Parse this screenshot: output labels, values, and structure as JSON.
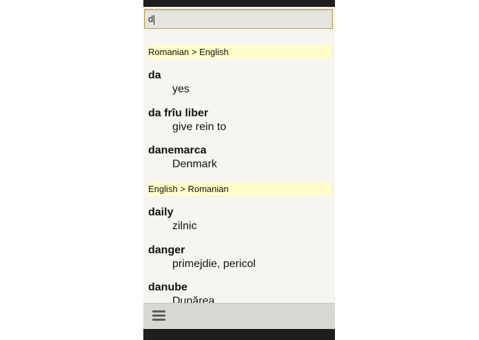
{
  "search": {
    "value": "d"
  },
  "sections": [
    {
      "header": "Romanian > English",
      "entries": [
        {
          "word": "da",
          "translation": "yes"
        },
        {
          "word": "da frîu liber",
          "translation": "give rein to"
        },
        {
          "word": "danemarca",
          "translation": "Denmark"
        }
      ]
    },
    {
      "header": "English > Romanian",
      "entries": [
        {
          "word": "daily",
          "translation": "zilnic"
        },
        {
          "word": "danger",
          "translation": "primejdie, pericol"
        },
        {
          "word": "danube",
          "translation": "Dunărea"
        }
      ]
    }
  ],
  "colors": {
    "section_header_bg": "#fffec8",
    "screen_bg": "#f7f5ef",
    "search_border": "#b8a24a",
    "bottom_bar_bg": "#d9d7d2"
  },
  "icons": {
    "menu": "menu-icon"
  }
}
